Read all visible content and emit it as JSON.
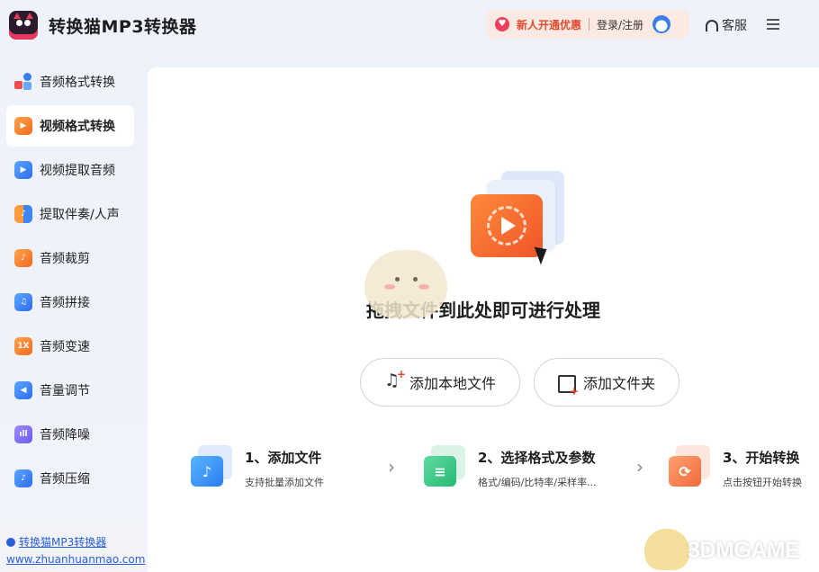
{
  "app": {
    "title": "转换猫MP3转换器",
    "logo_icon": "cat-logo-icon"
  },
  "header": {
    "promo_offer": "新人开通优惠",
    "login": "登录/注册",
    "service": "客服"
  },
  "sidebar": {
    "items": [
      {
        "label": "音频格式转换",
        "icon": "audio-format-icon",
        "active": false
      },
      {
        "label": "视频格式转换",
        "icon": "video-format-icon",
        "active": true
      },
      {
        "label": "视频提取音频",
        "icon": "video-extract-audio-icon",
        "active": false
      },
      {
        "label": "提取伴奏/人声",
        "icon": "extract-vocal-icon",
        "active": false
      },
      {
        "label": "音频裁剪",
        "icon": "audio-trim-icon",
        "active": false
      },
      {
        "label": "音频拼接",
        "icon": "audio-merge-icon",
        "active": false
      },
      {
        "label": "音频变速",
        "icon": "audio-speed-icon",
        "speed_text": "1X",
        "active": false
      },
      {
        "label": "音量调节",
        "icon": "volume-icon",
        "active": false
      },
      {
        "label": "音频降噪",
        "icon": "denoise-icon",
        "active": false
      },
      {
        "label": "音频压缩",
        "icon": "compress-icon",
        "active": false
      }
    ],
    "footer_name": "转换猫MP3转换器",
    "footer_url": "www.zhuanhuanmao.com"
  },
  "main": {
    "drag_hint": "拖拽文件到此处即可进行处理",
    "add_file_button": "添加本地文件",
    "add_folder_button": "添加文件夹",
    "steps": [
      {
        "title": "1、添加文件",
        "desc": "支持批量添加文件"
      },
      {
        "title": "2、选择格式及参数",
        "desc": "格式/编码/比特率/采样率..."
      },
      {
        "title": "3、开始转换",
        "desc": "点击按钮开始转换"
      }
    ]
  },
  "watermark": "3DMGAME",
  "colors": {
    "accent_orange": "#f0552a",
    "accent_blue": "#2d6bf0",
    "promo_red": "#e24a2e"
  }
}
